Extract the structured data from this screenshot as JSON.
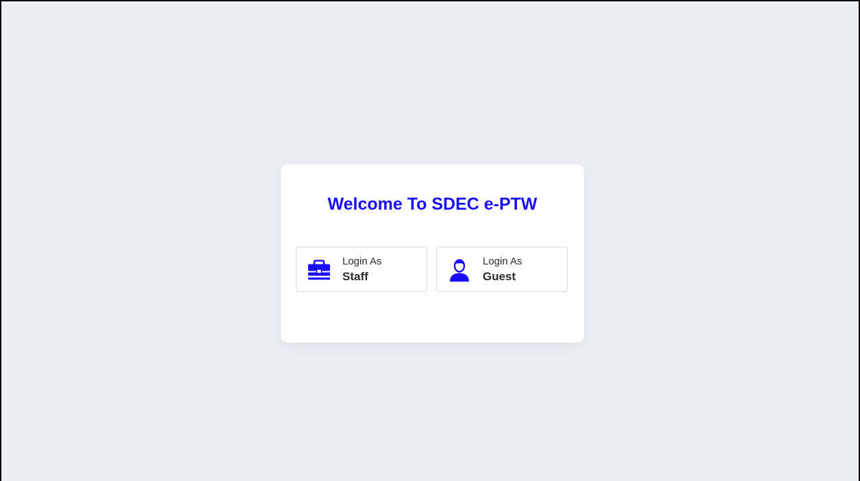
{
  "title": "Welcome To SDEC e-PTW",
  "colors": {
    "accent": "#1a0dff",
    "background": "#ebeff4",
    "card": "#ffffff",
    "text": "#2b2b2b"
  },
  "buttons": {
    "staff": {
      "prefix": "Login As",
      "label": "Staff",
      "icon": "briefcase-icon"
    },
    "guest": {
      "prefix": "Login As",
      "label": "Guest",
      "icon": "user-icon"
    }
  }
}
